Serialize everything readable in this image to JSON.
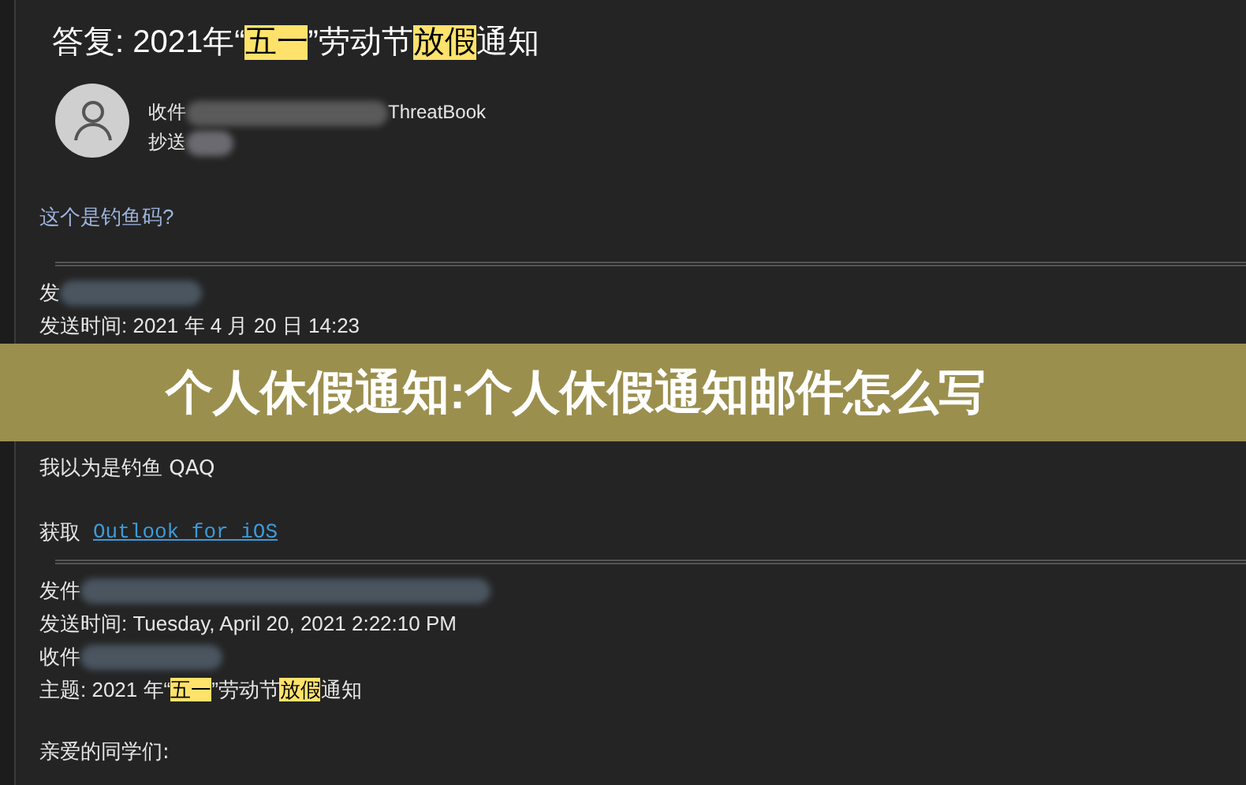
{
  "email": {
    "subject": [
      {
        "text": "答复: 2021年“",
        "highlighted": false
      },
      {
        "text": "五一",
        "highlighted": true
      },
      {
        "text": "”劳动节",
        "highlighted": false
      },
      {
        "text": "放假",
        "highlighted": true
      },
      {
        "text": "通知",
        "highlighted": false
      }
    ],
    "to_label": "收件",
    "to_suffix": "ThreatBook",
    "cc_label": "抄送",
    "body": [
      {
        "kind": "note",
        "text": "这个是钓鱼码?"
      },
      {
        "kind": "divider"
      },
      {
        "kind": "header",
        "text": "发"
      },
      {
        "kind": "header",
        "text": "发送时间: 2021 年 4 月 20 日 14:23"
      },
      {
        "kind": "covered"
      },
      {
        "kind": "para",
        "text": "我以为是钓鱼 QAQ"
      },
      {
        "kind": "gap"
      },
      {
        "kind": "link_para",
        "text": "获取",
        "link": "Outlook for iOS"
      },
      {
        "kind": "divider"
      },
      {
        "kind": "header",
        "text": "发件"
      },
      {
        "kind": "header",
        "text": "发送时间: Tuesday, April 20, 2021 2:22:10 PM"
      },
      {
        "kind": "header",
        "text": "收件"
      },
      {
        "kind": "subject",
        "segments": [
          {
            "text": "主题: 2021 年“",
            "highlighted": false
          },
          {
            "text": "五一",
            "highlighted": true
          },
          {
            "text": "”劳动节",
            "highlighted": false
          },
          {
            "text": "放假",
            "highlighted": true
          },
          {
            "text": "通知",
            "highlighted": false
          }
        ]
      },
      {
        "kind": "gap"
      },
      {
        "kind": "para",
        "text": "亲爱的同学们:"
      }
    ]
  },
  "banner": {
    "title": "个人休假通知:个人休假通知邮件怎么写"
  }
}
